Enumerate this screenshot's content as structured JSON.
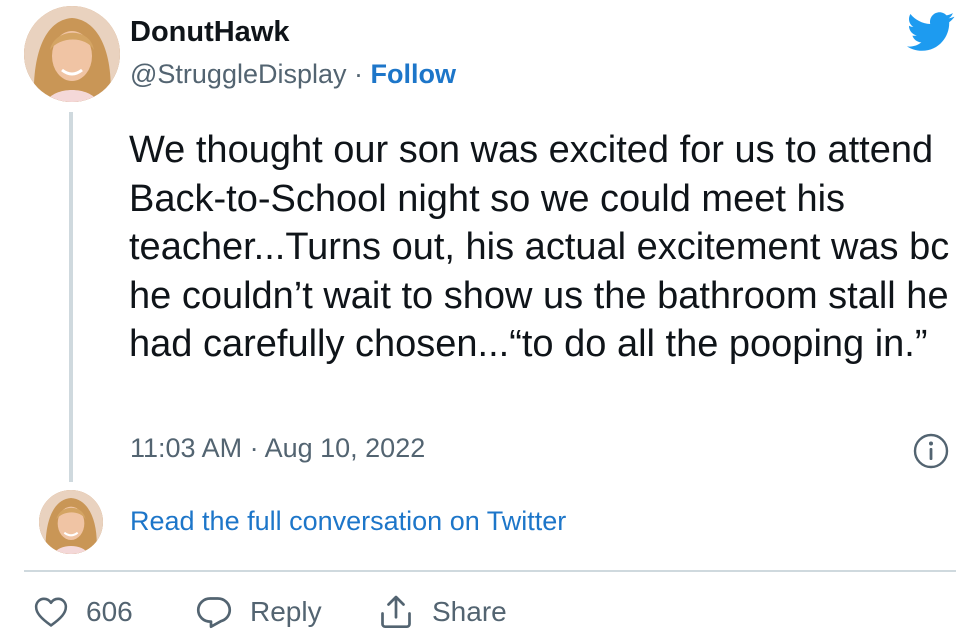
{
  "author": {
    "display_name": "DonutHawk",
    "handle": "@StruggleDisplay",
    "separator": " · ",
    "follow_label": "Follow"
  },
  "tweet": {
    "text": "We thought our son was excited for us to attend Back-to-School night so we could meet his teacher...Turns out, his actual excitement was bc he couldn’t wait to show us the bathroom stall he had carefully chosen...“to do all the pooping in.”",
    "timestamp": "11:03 AM · Aug 10, 2022"
  },
  "conversation": {
    "read_full_label": "Read the full conversation on Twitter"
  },
  "actions": {
    "like_count": "606",
    "reply_label": "Reply",
    "share_label": "Share"
  },
  "icons": {
    "brand": "twitter-bird-icon",
    "info": "info-icon",
    "like": "heart-icon",
    "reply": "speech-bubble-icon",
    "share": "share-icon"
  },
  "colors": {
    "twitter_blue": "#1d9bf0",
    "link_blue": "#1d76c9",
    "secondary_text": "#536471",
    "divider": "#cfd9de"
  }
}
